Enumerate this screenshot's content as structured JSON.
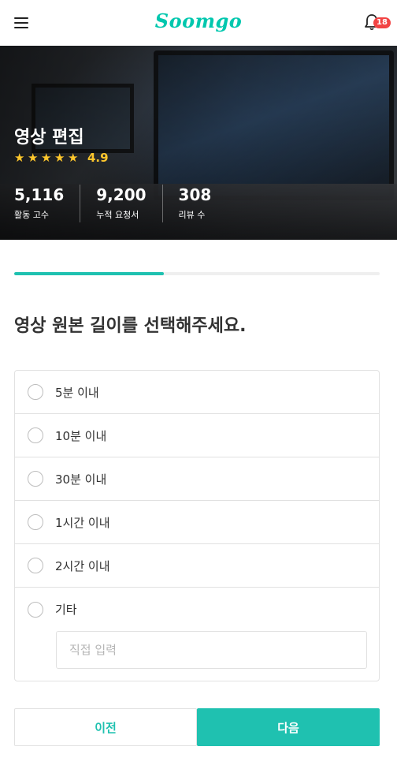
{
  "header": {
    "logo_text": "Soomgo",
    "notification_count": "18",
    "icons": {
      "menu": "hamburger-menu-icon",
      "notifications": "bell-icon"
    }
  },
  "hero": {
    "title": "영상 편집",
    "rating_value": "4.9",
    "star_count": 5,
    "stats": [
      {
        "value": "5,116",
        "label": "활동 고수"
      },
      {
        "value": "9,200",
        "label": "누적 요청서"
      },
      {
        "value": "308",
        "label": "리뷰 수"
      }
    ]
  },
  "progress": {
    "percent": 41
  },
  "question": "영상 원본 길이를 선택해주세요.",
  "options": [
    {
      "label": "5분 이내"
    },
    {
      "label": "10분 이내"
    },
    {
      "label": "30분 이내"
    },
    {
      "label": "1시간 이내"
    },
    {
      "label": "2시간 이내"
    },
    {
      "label": "기타"
    }
  ],
  "other_input": {
    "placeholder": "직접 입력",
    "value": ""
  },
  "buttons": {
    "prev": "이전",
    "next": "다음"
  },
  "colors": {
    "accent": "#1fc1b0",
    "star": "#ffc72c",
    "badge": "#f24444"
  }
}
